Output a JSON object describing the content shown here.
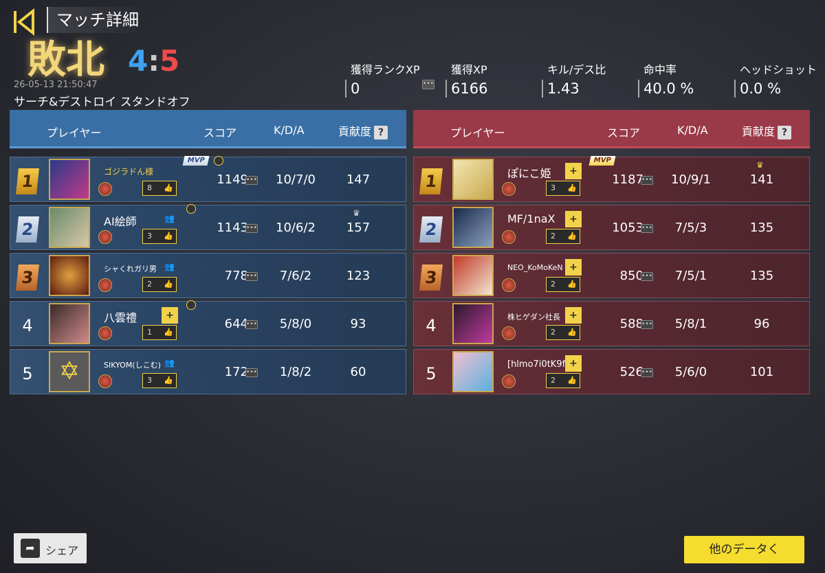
{
  "header": {
    "title": "マッチ詳細",
    "result": "敗北",
    "score_blue": "4",
    "score_sep": ":",
    "score_red": "5",
    "datetime": "26-05-13 21:50:47",
    "mode": "サーチ&デストロイ スタンドオフ"
  },
  "stats": [
    {
      "label": "獲得ランクXP",
      "value": "0"
    },
    {
      "label": "獲得XP",
      "value": "6166"
    },
    {
      "label": "キル/デス比",
      "value": "1.43"
    },
    {
      "label": "命中率",
      "value": "40.0 %"
    },
    {
      "label": "ヘッドショット",
      "value": "0.0 %"
    }
  ],
  "columns": {
    "player": "プレイヤー",
    "score": "スコア",
    "kda": "K/D/A",
    "contrib": "貢献度",
    "help": "?"
  },
  "blue": [
    {
      "rank": "1",
      "name": "ゴジラドん様",
      "likes": "8",
      "score": "1149",
      "kda": "10/7/0",
      "contrib": "147",
      "mvp": "MVP"
    },
    {
      "rank": "2",
      "name": "AI絵師",
      "likes": "3",
      "score": "1143",
      "kda": "10/6/2",
      "contrib": "157"
    },
    {
      "rank": "3",
      "name": "シャくれガリ男",
      "likes": "2",
      "score": "778",
      "kda": "7/6/2",
      "contrib": "123"
    },
    {
      "rank": "4",
      "name": "八雲禮",
      "likes": "1",
      "score": "644",
      "kda": "5/8/0",
      "contrib": "93"
    },
    {
      "rank": "5",
      "name": "SIKYOM(しこむ)",
      "likes": "3",
      "score": "172",
      "kda": "1/8/2",
      "contrib": "60"
    }
  ],
  "red": [
    {
      "rank": "1",
      "name": "ぽにこ姫",
      "likes": "3",
      "score": "1187",
      "kda": "10/9/1",
      "contrib": "141",
      "mvp": "MVP"
    },
    {
      "rank": "2",
      "name": "MF/1naX",
      "likes": "2",
      "score": "1053",
      "kda": "7/5/3",
      "contrib": "135"
    },
    {
      "rank": "3",
      "name": "NEO_KoMoKeN",
      "likes": "2",
      "score": "850",
      "kda": "7/5/1",
      "contrib": "135"
    },
    {
      "rank": "4",
      "name": "株ヒゲダン社長",
      "likes": "2",
      "score": "588",
      "kda": "5/8/1",
      "contrib": "96"
    },
    {
      "rank": "5",
      "name": "[hlmo7i0tK9f",
      "likes": "2",
      "score": "526",
      "kda": "5/6/0",
      "contrib": "101"
    }
  ],
  "footer": {
    "share": "シェア",
    "more": "他のデータく"
  },
  "colors": {
    "blue": "#3a6fa5",
    "red": "#9a3a48",
    "gold": "#f2d24a"
  }
}
